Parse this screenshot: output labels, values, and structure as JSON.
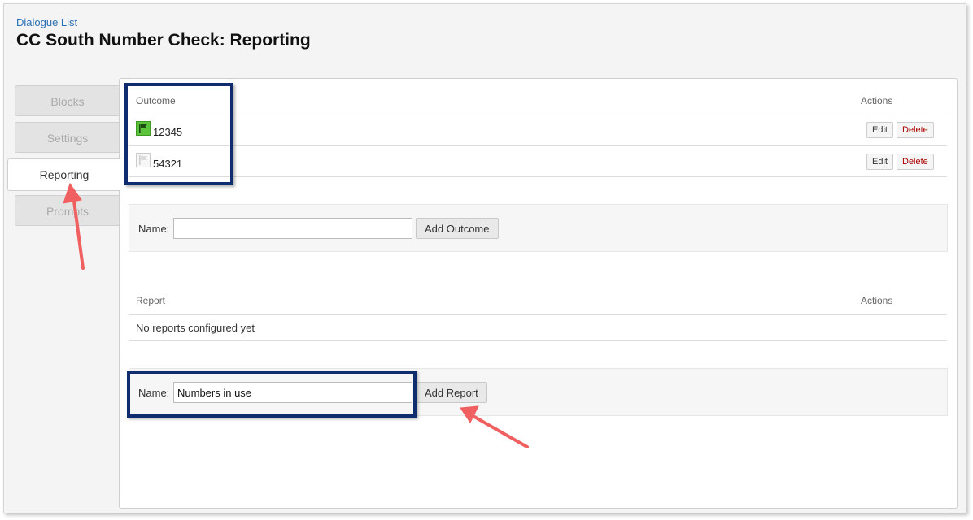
{
  "breadcrumb": "Dialogue List",
  "page_title": "CC South Number Check: Reporting",
  "tabs": [
    {
      "label": "Blocks",
      "active": false
    },
    {
      "label": "Settings",
      "active": false
    },
    {
      "label": "Reporting",
      "active": true
    },
    {
      "label": "Prompts",
      "active": false
    }
  ],
  "outcomes_table": {
    "col_outcome": "Outcome",
    "col_actions": "Actions",
    "rows": [
      {
        "name": "12345",
        "flag_icon": "flag-icon",
        "flagged": true,
        "edit": "Edit",
        "delete": "Delete"
      },
      {
        "name": "54321",
        "flag_icon": "flag-icon",
        "flagged": false,
        "edit": "Edit",
        "delete": "Delete"
      }
    ]
  },
  "add_outcome_form": {
    "label": "Name:",
    "value": "",
    "button": "Add Outcome"
  },
  "reports_table": {
    "col_report": "Report",
    "col_actions": "Actions",
    "empty_message": "No reports configured yet"
  },
  "add_report_form": {
    "label": "Name:",
    "value": "Numbers in use",
    "button": "Add Report"
  },
  "colors": {
    "link": "#2a6fb5",
    "flag_on": "#5cc43c",
    "delete_text": "#aa0000",
    "annotation_box": "#0f2c6e",
    "annotation_arrow": "#f06060"
  }
}
